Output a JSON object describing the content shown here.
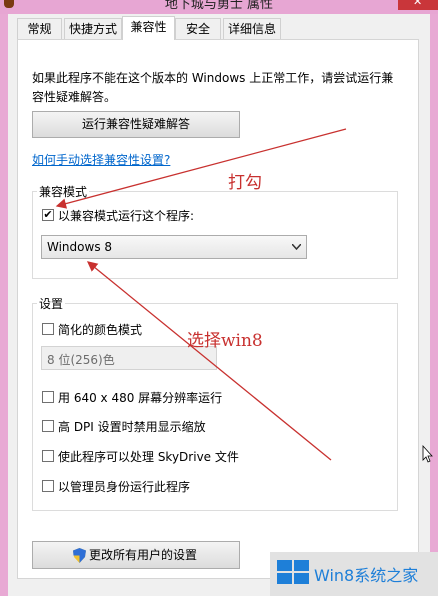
{
  "window": {
    "title": "地下城与勇士 属性",
    "close_glyph": "✕"
  },
  "tabs": [
    {
      "label": "常规",
      "active": false
    },
    {
      "label": "快捷方式",
      "active": false
    },
    {
      "label": "兼容性",
      "active": true
    },
    {
      "label": "安全",
      "active": false
    },
    {
      "label": "详细信息",
      "active": false
    }
  ],
  "intro": {
    "line1": "如果此程序不能在这个版本的 Windows 上正常工作，请尝试运行兼",
    "line2": "容性疑难解答。"
  },
  "troubleshoot_button": "运行兼容性疑难解答",
  "manual_link": "如何手动选择兼容性设置?",
  "compat_mode": {
    "legend": "兼容模式",
    "checkbox_label": "以兼容模式运行这个程序:",
    "checked": true,
    "check_glyph": "✔",
    "selected_os": "Windows 8"
  },
  "settings": {
    "legend": "设置",
    "reduced_color": {
      "label": "简化的颜色模式",
      "checked": false
    },
    "color_select": "8 位(256)色",
    "res_640": {
      "label": "用 640 x 480 屏幕分辨率运行",
      "checked": false
    },
    "high_dpi": {
      "label": "高 DPI 设置时禁用显示缩放",
      "checked": false
    },
    "skydrive": {
      "label": "使此程序可以处理 SkyDrive 文件",
      "checked": false
    },
    "admin": {
      "label": "以管理员身份运行此程序",
      "checked": false
    }
  },
  "all_users_button": "更改所有用户的设置",
  "annotations": {
    "check_note": "打勾",
    "win8_note": "选择win8",
    "color": "#c8312f"
  },
  "watermark": {
    "text": "Win8系统之家",
    "color": "#1e7fd8"
  },
  "colors": {
    "window_bg": "#e8a9d4",
    "link": "#0066cc"
  }
}
